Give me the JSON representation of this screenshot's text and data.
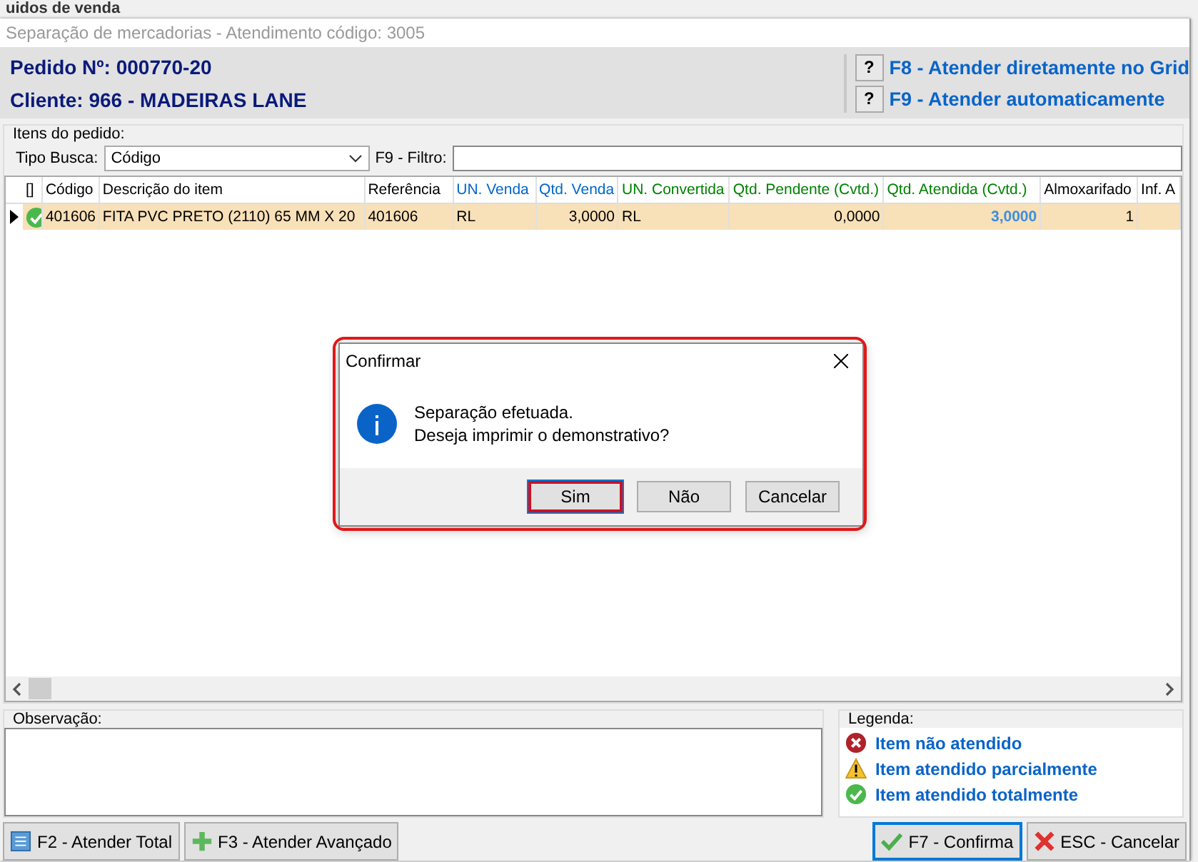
{
  "background_title": "uidos de venda",
  "window": {
    "title": "Separação de mercadorias - Atendimento código: 3005"
  },
  "header": {
    "order": "Pedido Nº: 000770-20",
    "client": "Cliente: 966 - MADEIRAS LANE",
    "shortcuts": [
      {
        "key": "?",
        "label": "F8 - Atender diretamente no Grid"
      },
      {
        "key": "?",
        "label": "F9 - Atender automaticamente"
      }
    ]
  },
  "items_group": {
    "title": "Itens do pedido:",
    "search_type_label": "Tipo Busca:",
    "search_type_value": "Código",
    "filter_label": "F9 - Filtro:"
  },
  "table": {
    "columns": [
      {
        "label": "[]",
        "color": "#000000"
      },
      {
        "label": "Código",
        "color": "#000000"
      },
      {
        "label": "Descrição do item",
        "color": "#000000"
      },
      {
        "label": "Referência",
        "color": "#000000"
      },
      {
        "label": "UN. Venda",
        "color": "#0066cc"
      },
      {
        "label": "Qtd. Venda",
        "color": "#0066cc"
      },
      {
        "label": "UN. Convertida",
        "color": "#008000"
      },
      {
        "label": "Qtd. Pendente (Cvtd.)",
        "color": "#008000"
      },
      {
        "label": "Qtd. Atendida (Cvtd.)",
        "color": "#008000"
      },
      {
        "label": "Almoxarifado",
        "color": "#000000"
      },
      {
        "label": "Inf. A",
        "color": "#000000"
      }
    ],
    "rows": [
      {
        "selected": true,
        "cells": [
          {
            "kind": "success"
          },
          {
            "text": "401606",
            "kind": "text"
          },
          {
            "text": "FITA PVC PRETO (2110) 65 MM X 20",
            "kind": "text"
          },
          {
            "text": "401606",
            "kind": "text"
          },
          {
            "text": "RL",
            "kind": "text"
          },
          {
            "text": "3,0000",
            "kind": "number"
          },
          {
            "text": "RL",
            "kind": "text"
          },
          {
            "text": "0,0000",
            "kind": "number"
          },
          {
            "text": "3,0000",
            "kind": "emphasis"
          },
          {
            "text": "1",
            "kind": "number"
          },
          {
            "text": "",
            "kind": "text"
          }
        ]
      }
    ]
  },
  "dialog": {
    "title": "Confirmar",
    "message_lines": [
      "Separação efetuada.",
      "Deseja imprimir o demonstrativo?"
    ],
    "buttons": [
      {
        "label": "Sim",
        "focused": true
      },
      {
        "label": "Não",
        "focused": false
      },
      {
        "label": "Cancelar",
        "focused": false
      }
    ]
  },
  "notes": {
    "title": "Observação:"
  },
  "legend": {
    "title": "Legenda:",
    "items": [
      {
        "kind": "error",
        "label": "Item não atendido"
      },
      {
        "kind": "warning",
        "label": "Item atendido parcialmente"
      },
      {
        "kind": "success",
        "label": "Item atendido totalmente"
      }
    ]
  },
  "footer_left": [
    {
      "kind": "list",
      "label": "F2 - Atender Total",
      "focused": false
    },
    {
      "kind": "plus",
      "label": "F3 - Atender Avançado",
      "focused": false
    }
  ],
  "footer_right": [
    {
      "kind": "check",
      "label": "F7 - Confirma",
      "focused": true
    },
    {
      "kind": "cross",
      "label": "ESC - Cancelar",
      "focused": false
    }
  ]
}
